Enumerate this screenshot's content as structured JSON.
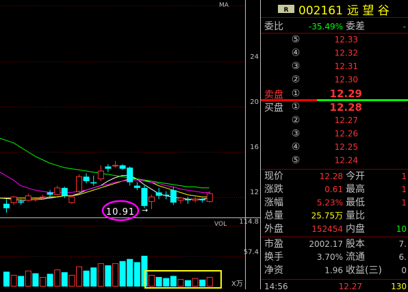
{
  "chart_data": {
    "type": "candlestick",
    "price_axis_ticks": [
      12,
      16,
      20,
      24
    ],
    "volume_axis_ticks": [
      57.4,
      114.8
    ],
    "price_axis_label": "MA",
    "volume_axis_label": "VOL",
    "volume_unit": "X万",
    "annotation_low": "10.91",
    "candles": [
      {
        "o": 11.4,
        "c": 11.0,
        "h": 11.8,
        "l": 10.6
      },
      {
        "o": 11.5,
        "c": 12.0,
        "h": 12.1,
        "l": 11.3
      },
      {
        "o": 11.6,
        "c": 11.5,
        "h": 11.8,
        "l": 11.3
      },
      {
        "o": 11.7,
        "c": 12.1,
        "h": 12.3,
        "l": 11.6
      },
      {
        "o": 11.8,
        "c": 11.8,
        "h": 12.0,
        "l": 11.6
      },
      {
        "o": 12.0,
        "c": 12.0,
        "h": 12.2,
        "l": 11.8
      },
      {
        "o": 12.4,
        "c": 12.2,
        "h": 12.6,
        "l": 12.0
      },
      {
        "o": 12.2,
        "c": 12.8,
        "h": 13.0,
        "l": 12.1
      },
      {
        "o": 12.8,
        "c": 12.1,
        "h": 12.9,
        "l": 11.9
      },
      {
        "o": 11.5,
        "c": 12.0,
        "h": 12.2,
        "l": 11.4
      },
      {
        "o": 12.5,
        "c": 13.8,
        "h": 14.0,
        "l": 12.3
      },
      {
        "o": 13.8,
        "c": 13.4,
        "h": 14.1,
        "l": 13.2
      },
      {
        "o": 13.3,
        "c": 13.2,
        "h": 13.9,
        "l": 13.0
      },
      {
        "o": 13.6,
        "c": 14.3,
        "h": 14.8,
        "l": 13.4
      },
      {
        "o": 14.7,
        "c": 14.5,
        "h": 14.9,
        "l": 14.2
      },
      {
        "o": 14.8,
        "c": 14.8,
        "h": 15.2,
        "l": 14.6
      },
      {
        "o": 14.8,
        "c": 14.5,
        "h": 14.9,
        "l": 14.4
      },
      {
        "o": 14.6,
        "c": 13.3,
        "h": 14.7,
        "l": 13.0
      },
      {
        "o": 13.0,
        "c": 12.8,
        "h": 13.3,
        "l": 12.6
      },
      {
        "o": 12.8,
        "c": 11.2,
        "h": 13.0,
        "l": 11.0
      },
      {
        "o": 11.6,
        "c": 12.0,
        "h": 12.2,
        "l": 10.91
      },
      {
        "o": 12.4,
        "c": 12.1,
        "h": 12.8,
        "l": 11.8
      },
      {
        "o": 12.2,
        "c": 12.1,
        "h": 12.5,
        "l": 11.8
      },
      {
        "o": 12.6,
        "c": 11.5,
        "h": 12.9,
        "l": 11.3
      },
      {
        "o": 11.7,
        "c": 11.9,
        "h": 12.0,
        "l": 11.4
      },
      {
        "o": 11.8,
        "c": 11.7,
        "h": 12.0,
        "l": 11.4
      },
      {
        "o": 11.7,
        "c": 11.8,
        "h": 12.0,
        "l": 11.5
      },
      {
        "o": 11.8,
        "c": 11.7,
        "h": 11.9,
        "l": 11.5
      },
      {
        "o": 11.6,
        "c": 12.3,
        "h": 12.5,
        "l": 11.5
      }
    ],
    "ma_lines": [
      {
        "color": "#ffffff",
        "values": [
          11.9,
          11.8,
          11.7,
          11.7,
          11.8,
          11.8,
          11.9,
          12.0,
          12.1,
          12.1,
          12.3,
          12.6,
          12.8,
          13.0,
          13.4,
          13.7,
          13.9,
          13.9,
          13.6,
          13.1,
          12.7,
          12.3,
          12.1,
          12.0,
          11.9,
          11.8,
          11.8,
          11.8,
          11.9
        ]
      },
      {
        "color": "#ffff00",
        "values": [
          11.9,
          11.9,
          11.9,
          11.9,
          11.9,
          11.9,
          12.0,
          12.0,
          12.1,
          12.1,
          12.2,
          12.4,
          12.6,
          12.8,
          13.0,
          13.2,
          13.4,
          13.6,
          13.6,
          13.5,
          13.3,
          13.0,
          12.8,
          12.6,
          12.4,
          12.2,
          12.1,
          12.0,
          12.0
        ]
      },
      {
        "color": "#ff00ff",
        "values": [
          14.2,
          13.5,
          13.0,
          12.8,
          12.6,
          12.5,
          12.4,
          12.4,
          12.4,
          12.4,
          12.5,
          12.6,
          12.8,
          13.0,
          13.1,
          13.3,
          13.4,
          13.5,
          13.5,
          13.4,
          13.3,
          13.2,
          13.0,
          12.9,
          12.7,
          12.6,
          12.5,
          12.4,
          12.4
        ]
      },
      {
        "color": "#00ff00",
        "values": [
          17.2,
          16.8,
          16.4,
          16.0,
          15.6,
          15.3,
          15.0,
          14.8,
          14.6,
          14.5,
          14.4,
          14.3,
          14.2,
          14.1,
          14.0,
          13.9,
          13.8,
          13.7,
          13.6,
          13.5,
          13.4,
          13.3,
          13.2,
          13.1,
          13.0,
          12.9,
          12.9,
          12.8,
          12.8
        ]
      }
    ],
    "volumes": [
      {
        "v": 28,
        "up": false
      },
      {
        "v": 22,
        "up": true
      },
      {
        "v": 20,
        "up": false
      },
      {
        "v": 30,
        "up": true
      },
      {
        "v": 25,
        "up": false
      },
      {
        "v": 18,
        "up": true
      },
      {
        "v": 24,
        "up": false
      },
      {
        "v": 32,
        "up": true
      },
      {
        "v": 27,
        "up": false
      },
      {
        "v": 22,
        "up": true
      },
      {
        "v": 38,
        "up": true
      },
      {
        "v": 30,
        "up": false
      },
      {
        "v": 36,
        "up": false
      },
      {
        "v": 44,
        "up": true
      },
      {
        "v": 40,
        "up": false
      },
      {
        "v": 44,
        "up": true
      },
      {
        "v": 48,
        "up": false
      },
      {
        "v": 52,
        "up": false
      },
      {
        "v": 46,
        "up": false
      },
      {
        "v": 58,
        "up": false
      },
      {
        "v": 22,
        "up": true
      },
      {
        "v": 18,
        "up": false
      },
      {
        "v": 16,
        "up": false
      },
      {
        "v": 20,
        "up": false
      },
      {
        "v": 14,
        "up": true
      },
      {
        "v": 12,
        "up": false
      },
      {
        "v": 16,
        "up": true
      },
      {
        "v": 13,
        "up": false
      },
      {
        "v": 18,
        "up": true
      }
    ],
    "highlight_box_color": "#ffff00",
    "annotation_ellipse_color": "#ff00ff",
    "colors": {
      "up": "#ff3232",
      "down": "#00ffff",
      "grid": "#800000",
      "axis": "#c0c0c0"
    }
  },
  "quote_panel": {
    "badge": "R",
    "code": "002161",
    "name": "远 望 谷",
    "weibi_label": "委比",
    "weibi_value": "-35.49%",
    "weicha_label": "委差",
    "weicha_value": "-",
    "sell_levels": [
      {
        "num": "⑤",
        "price": "12.33"
      },
      {
        "num": "④",
        "price": "12.32"
      },
      {
        "num": "③",
        "price": "12.31"
      },
      {
        "num": "②",
        "price": "12.30"
      }
    ],
    "sell1": {
      "label": "卖盘",
      "num": "①",
      "price": "12.29"
    },
    "buy1": {
      "label": "买盘",
      "num": "①",
      "price": "12.28"
    },
    "buy_levels": [
      {
        "num": "②",
        "price": "12.27"
      },
      {
        "num": "③",
        "price": "12.26"
      },
      {
        "num": "④",
        "price": "12.25"
      },
      {
        "num": "⑤",
        "price": "12.24"
      }
    ],
    "stats": [
      {
        "l1": "现价",
        "v1": "12.28",
        "c1": "#ff3232",
        "l2": "今开",
        "v2": "1",
        "c2": "#ff3232"
      },
      {
        "l1": "涨跌",
        "v1": "0.61",
        "c1": "#ff3232",
        "l2": "最高",
        "v2": "1",
        "c2": "#ff3232"
      },
      {
        "l1": "涨幅",
        "v1": "5.23%",
        "c1": "#ff3232",
        "l2": "最低",
        "v2": "1",
        "c2": "#ff3232"
      },
      {
        "l1": "总量",
        "v1": "25.75万",
        "c1": "#ffff00",
        "l2": "量比",
        "v2": "",
        "c2": "#ffff00"
      },
      {
        "l1": "外盘",
        "v1": "152454",
        "c1": "#ff3232",
        "l2": "内盘",
        "v2": "10",
        "c2": "#00ff00"
      }
    ],
    "stats2": [
      {
        "l1": "市盈",
        "v1": "2002.17",
        "c1": "#c0c0c0",
        "l2": "股本",
        "v2": "7.",
        "c2": "#c0c0c0"
      },
      {
        "l1": "换手",
        "v1": "3.70%",
        "c1": "#c0c0c0",
        "l2": "流通",
        "v2": "6.",
        "c2": "#c0c0c0"
      },
      {
        "l1": "净资",
        "v1": "1.96",
        "c1": "#c0c0c0",
        "l2": "收益(三)",
        "v2": "0",
        "c2": "#c0c0c0"
      }
    ],
    "tick": {
      "time": "14:56",
      "price": "12.27",
      "vol": "130"
    }
  }
}
